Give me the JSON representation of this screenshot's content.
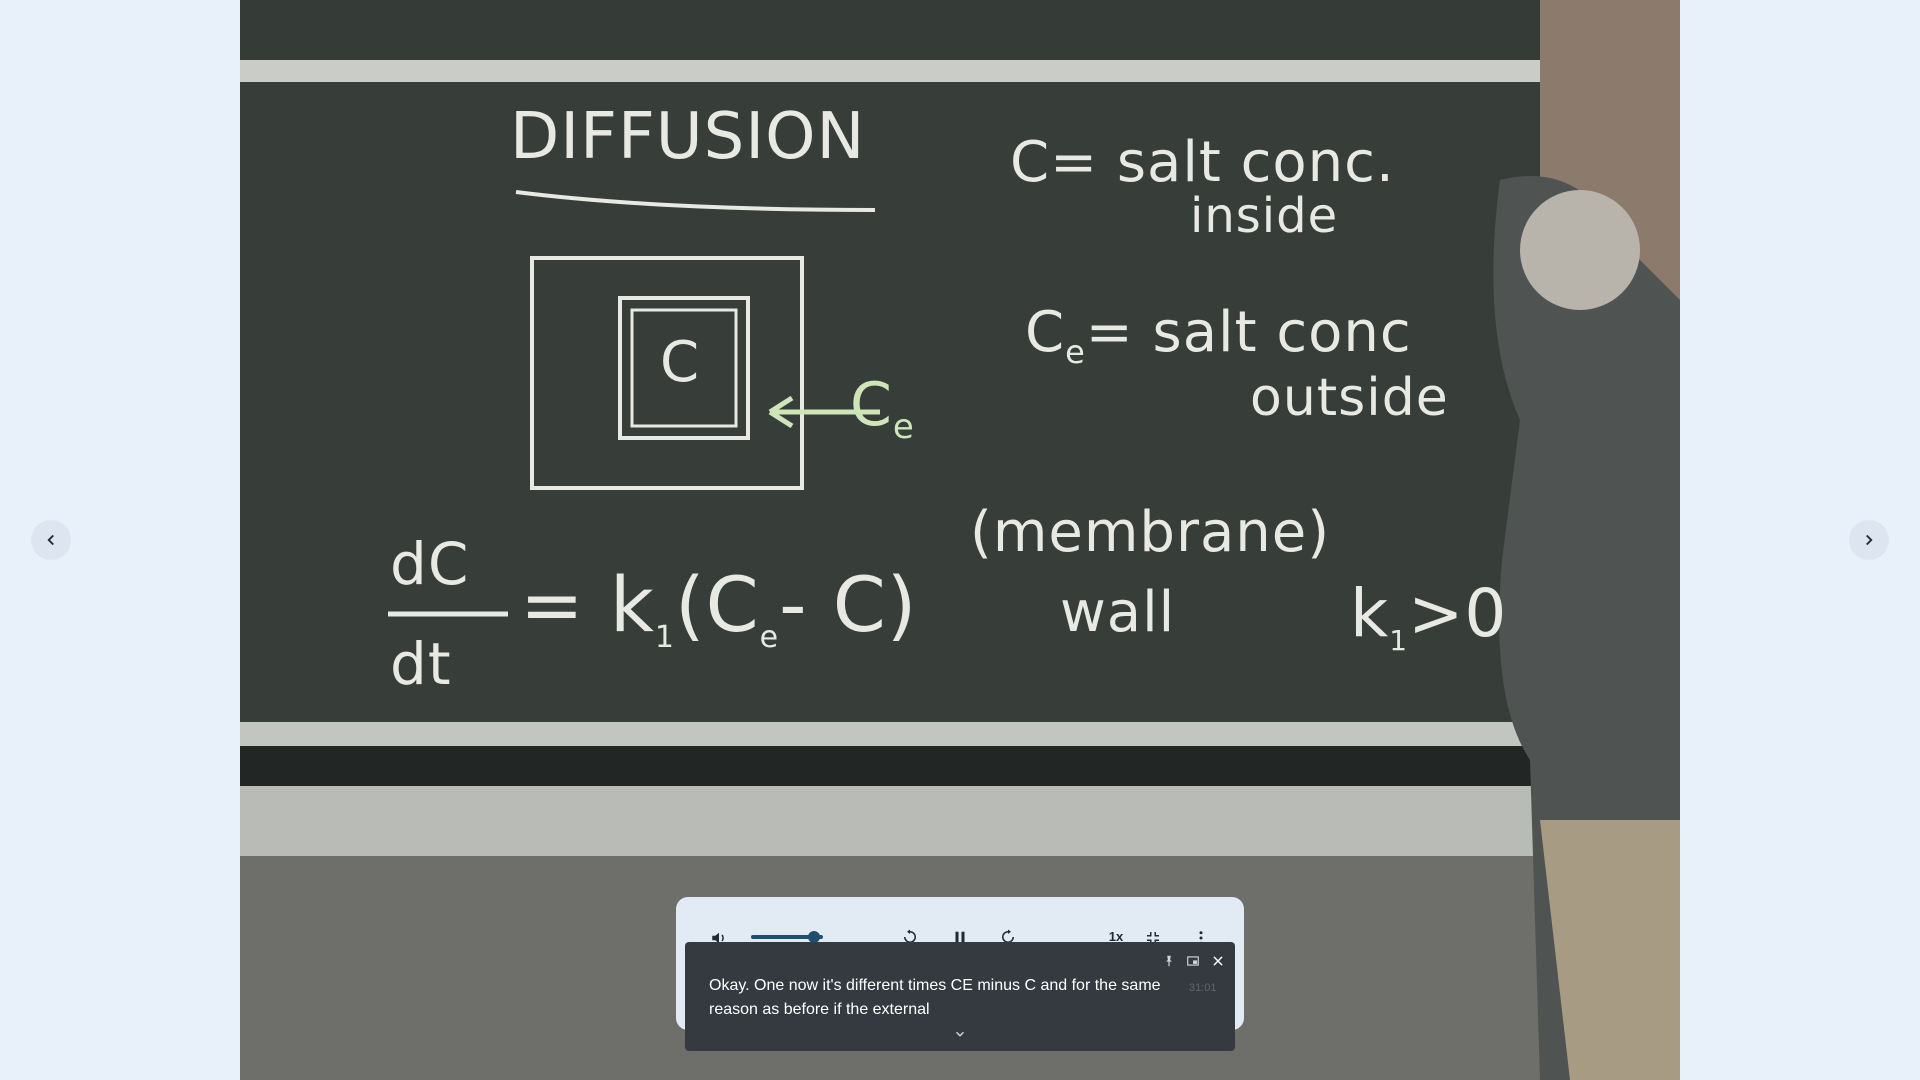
{
  "board": {
    "title": "DIFFUSION",
    "def_c_line1": "C= salt conc.",
    "def_c_line2": "inside",
    "def_ce_line1": "C",
    "def_ce_sub": "e",
    "def_ce_line1b": "= salt conc",
    "def_ce_line2": "outside",
    "box_label": "C",
    "arrow_label": "C",
    "arrow_label_sub": "e",
    "eq_numerator": "dC",
    "eq_denominator": "dt",
    "eq_rhs": "= k",
    "eq_rhs_sub": "1",
    "eq_paren": "(C",
    "eq_paren_sub": "e",
    "eq_paren_end": "- C)",
    "membrane_line1": "(membrane)",
    "membrane_line2": "wall",
    "k_condition": "k",
    "k_condition_sub": "1",
    "k_condition_end": ">0"
  },
  "player": {
    "speed_label": "1x",
    "volume_level": 0.88
  },
  "caption": {
    "text": "Okay. One now it's different times CE minus C and for the same reason as before if the external",
    "timestamp": "31:01"
  },
  "icons": {
    "prev": "chevron-left-icon",
    "next": "chevron-right-icon",
    "volume": "volume-icon",
    "rewind": "rewind-10-icon",
    "pause": "pause-icon",
    "forward": "forward-10-icon",
    "exit_fullscreen": "exit-fullscreen-icon",
    "more": "more-vertical-icon",
    "pin": "pin-icon",
    "pip": "picture-in-picture-icon",
    "close": "close-icon",
    "expand": "chevron-down-icon"
  }
}
